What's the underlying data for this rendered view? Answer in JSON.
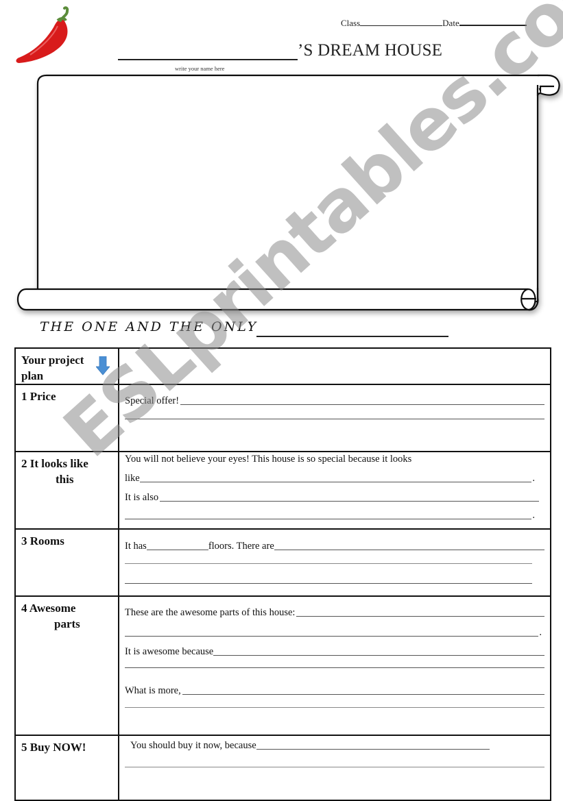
{
  "header": {
    "class_label": "Class",
    "date_label": "Date",
    "title_suffix": "’S DREAM HOUSE",
    "name_hint": "write your name here",
    "decoration_icon": "chili-pepper-icon"
  },
  "scroll_frame": {
    "icon": "paper-scroll-frame",
    "content": ""
  },
  "subtitle": {
    "text": "THE ONE AND THE ONLY"
  },
  "plan_table": {
    "header_label": "Your project plan",
    "header_icon": "down-arrow-icon",
    "header_icon_color": "#4a8fd4",
    "rows": [
      {
        "label_line1": "1  Price",
        "label_line2": "",
        "lines": [
          {
            "prefix": "Special offer! "
          },
          {
            "prefix": ""
          }
        ]
      },
      {
        "label_line1": "2  It looks like",
        "label_line2": "this",
        "intro": "You will not believe your eyes! This house is so special because it looks",
        "lines": [
          {
            "prefix": "like",
            "suffix": "."
          },
          {
            "prefix": "It is also "
          },
          {
            "prefix": "",
            "suffix": "."
          }
        ]
      },
      {
        "label_line1": "3  Rooms",
        "label_line2": "",
        "lines": [
          {
            "prefix": "It has",
            "middle": "floors. There are"
          },
          {
            "prefix": ""
          },
          {
            "prefix": ""
          }
        ]
      },
      {
        "label_line1": "4   Awesome",
        "label_line2": "parts",
        "lines": [
          {
            "prefix": "These are the awesome parts of this house: "
          },
          {
            "prefix": "",
            "suffix": "."
          },
          {
            "prefix": "It is awesome because"
          },
          {
            "prefix": ""
          },
          {
            "prefix": "What is more, "
          },
          {
            "prefix": ""
          }
        ]
      },
      {
        "label_line1": "5  Buy NOW!",
        "label_line2": "",
        "lines": [
          {
            "prefix": "You should buy it now, because"
          },
          {
            "prefix": ""
          }
        ]
      }
    ]
  },
  "watermark": {
    "text": "ESLprintables.com",
    "color": "#8c8c8c"
  }
}
